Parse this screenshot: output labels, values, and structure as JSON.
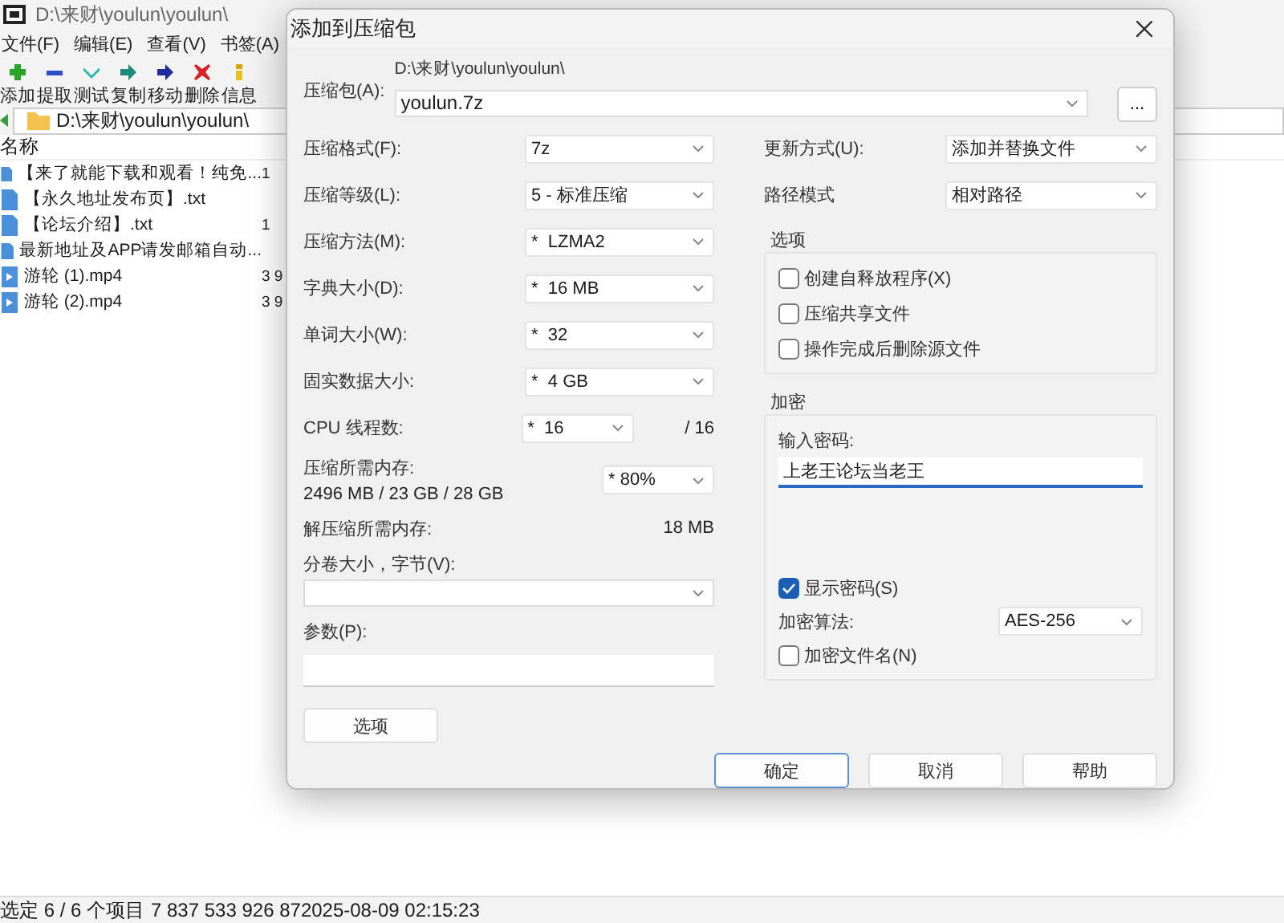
{
  "main_window": {
    "title": "D:\\来财\\youlun\\youlun\\",
    "menu": [
      "文件(F)",
      "编辑(E)",
      "查看(V)",
      "书签(A)"
    ],
    "toolbar": [
      {
        "label": "添加",
        "kind": "add"
      },
      {
        "label": "提取",
        "kind": "extract"
      },
      {
        "label": "测试",
        "kind": "test"
      },
      {
        "label": "复制",
        "kind": "copy"
      },
      {
        "label": "移动",
        "kind": "move"
      },
      {
        "label": "删除",
        "kind": "delete"
      },
      {
        "label": "信息",
        "kind": "info"
      }
    ],
    "address": "D:\\来财\\youlun\\youlun\\",
    "column_name": "名称",
    "files": [
      {
        "name": "【来了就能下载和观看！纯免...",
        "kind": "text",
        "size": "1"
      },
      {
        "name": "【永久地址发布页】.txt",
        "kind": "text"
      },
      {
        "name": "【论坛介绍】.txt",
        "kind": "text",
        "size": "1"
      },
      {
        "name": "最新地址及APP请发邮箱自动...",
        "kind": "text"
      },
      {
        "name": "游轮 (1).mp4",
        "kind": "video",
        "size": "3 9"
      },
      {
        "name": "游轮 (2).mp4",
        "kind": "video",
        "size": "3 9"
      }
    ],
    "status_bar": {
      "selection": "选定 6 / 6 个项目",
      "size": "7 837 53",
      "packed": "3 926 87",
      "modified": "2025-08-09 02:15:23"
    }
  },
  "dialog": {
    "title": "添加到压缩包",
    "archive": {
      "label": "压缩包(A):",
      "folder": "D:\\来财\\youlun\\youlun\\",
      "value": "youlun.7z",
      "browse": "..."
    },
    "settings": [
      {
        "label": "压缩格式(F):",
        "value": "7z"
      },
      {
        "label": "压缩等级(L):",
        "value": "5 - 标准压缩"
      },
      {
        "label": "压缩方法(M):",
        "value": "*  LZMA2"
      },
      {
        "label": "字典大小(D):",
        "value": "*  16 MB"
      },
      {
        "label": "单词大小(W):",
        "value": "*  32"
      },
      {
        "label": "固实数据大小:",
        "value": "*  4 GB"
      }
    ],
    "threads": {
      "label": "CPU 线程数:",
      "value": "*  16",
      "max": "/ 16"
    },
    "memory": {
      "label": "压缩所需内存:",
      "value": "2496 MB / 23 GB / 28 GB",
      "limit": "* 80%"
    },
    "decompress_memory": {
      "label": "解压缩所需内存:",
      "value": "18 MB"
    },
    "volume": {
      "label": "分卷大小，字节(V):"
    },
    "parameters": {
      "label": "参数(P):"
    },
    "options_button": "选项",
    "update_mode": {
      "label": "更新方式(U):",
      "value": "添加并替换文件"
    },
    "path_mode": {
      "label": "路径模式",
      "value": "相对路径"
    },
    "options_group": {
      "title": "选项",
      "items": [
        {
          "label": "创建自释放程序(X)",
          "checked": false
        },
        {
          "label": "压缩共享文件",
          "checked": false
        },
        {
          "label": "操作完成后删除源文件",
          "checked": false
        }
      ]
    },
    "encryption": {
      "title": "加密",
      "password_label": "输入密码:",
      "password": "上老王论坛当老王",
      "show_password": {
        "label": "显示密码(S)",
        "checked": true
      },
      "method": {
        "label": "加密算法:",
        "value": "AES-256"
      },
      "encrypt_names": {
        "label": "加密文件名(N)",
        "checked": false
      }
    },
    "buttons": [
      {
        "label": "确定",
        "default": true
      },
      {
        "label": "取消",
        "default": false
      },
      {
        "label": "帮助",
        "default": false
      }
    ]
  }
}
